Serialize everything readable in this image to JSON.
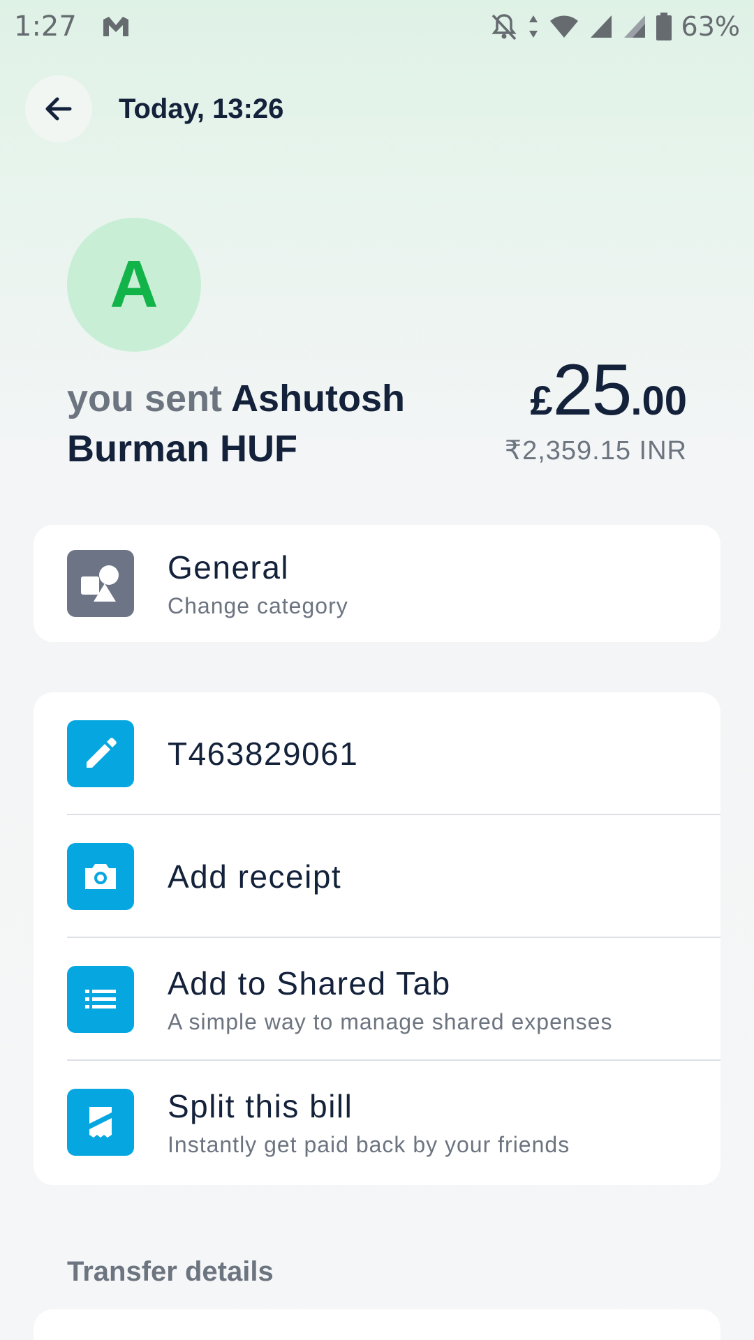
{
  "status_bar": {
    "time": "1:27",
    "battery": "63%",
    "icons": [
      "gmail-icon",
      "notifications-off-icon",
      "data-arrows-icon",
      "wifi-icon",
      "signal-icon",
      "signal-icon-2",
      "battery-icon"
    ]
  },
  "header": {
    "back_icon": "back-arrow-icon",
    "title": "Today, 13:26"
  },
  "avatar": {
    "letter": "A"
  },
  "summary": {
    "prefix": "you sent",
    "recipient": "Ashutosh Burman HUF",
    "amount": {
      "currency": "£",
      "integer": "25",
      "decimal": ".00"
    },
    "converted": "₹2,359.15 INR"
  },
  "category": {
    "title": "General",
    "subtitle": "Change category",
    "icon": "shapes-icon"
  },
  "actions": [
    {
      "title": "T463829061",
      "subtitle": "",
      "icon": "pencil-icon"
    },
    {
      "title": "Add receipt",
      "subtitle": "",
      "icon": "camera-icon"
    },
    {
      "title": "Add to Shared Tab",
      "subtitle": "A simple way to manage shared expenses",
      "icon": "list-icon"
    },
    {
      "title": "Split this bill",
      "subtitle": "Instantly get paid back by your friends",
      "icon": "receipt-icon"
    }
  ],
  "transfer_details": {
    "label": "Transfer details"
  },
  "colors": {
    "accent_blue": "#06a6e0",
    "avatar_bg": "#c8efd6",
    "avatar_fg": "#12b44a",
    "category_tile": "#6c7486"
  }
}
